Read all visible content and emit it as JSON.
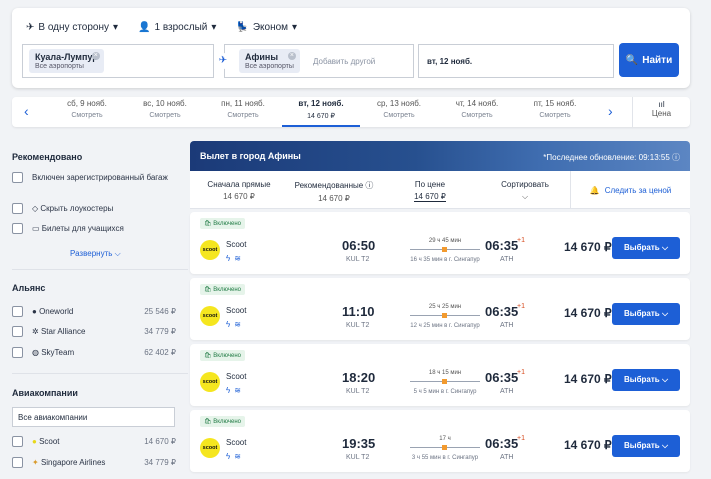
{
  "search": {
    "trip_type": "В одну сторону",
    "passengers": "1 взрослый",
    "cabin": "Эконом",
    "from": {
      "city": "Куала-Лумпур",
      "sub": "Все аэропорты"
    },
    "to": {
      "city": "Афины",
      "sub": "Все аэропорты"
    },
    "add_other": "Добавить другой",
    "date": "вт, 12 нояб.",
    "find_label": "Найти"
  },
  "dates": [
    {
      "day": "сб, 9 нояб.",
      "price": "Смотреть"
    },
    {
      "day": "вс, 10 нояб.",
      "price": "Смотреть"
    },
    {
      "day": "пн, 11 нояб.",
      "price": "Смотреть"
    },
    {
      "day": "вт, 12 нояб.",
      "price": "14 670 ₽",
      "selected": true
    },
    {
      "day": "ср, 13 нояб.",
      "price": "Смотреть"
    },
    {
      "day": "чт, 14 нояб.",
      "price": "Смотреть"
    },
    {
      "day": "пт, 15 нояб.",
      "price": "Смотреть"
    }
  ],
  "price_chart_label": "Цена",
  "sidebar": {
    "recommended_title": "Рекомендовано",
    "recommended": [
      "Включен зарегистрированный багаж",
      "Скрыть лоукостеры",
      "Билеты для учащихся"
    ],
    "expand": "Развернуть",
    "alliance_title": "Альянс",
    "alliances": [
      {
        "name": "Oneworld",
        "price": "25 546 ₽"
      },
      {
        "name": "Star Alliance",
        "price": "34 779 ₽"
      },
      {
        "name": "SkyTeam",
        "price": "62 402 ₽"
      }
    ],
    "airlines_title": "Авиакомпании",
    "airlines_all": "Все авиакомпании",
    "airlines": [
      {
        "name": "Scoot",
        "price": "14 670 ₽"
      },
      {
        "name": "Singapore Airlines",
        "price": "34 779 ₽"
      }
    ]
  },
  "results": {
    "banner_title": "Вылет в город Афины",
    "updated": "*Последнее обновление: 09:13:55",
    "sort": [
      {
        "label": "Сначала прямые",
        "value": "14 670 ₽"
      },
      {
        "label": "Рекомендованные",
        "value": "14 670 ₽"
      },
      {
        "label": "По цене",
        "value": "14 670 ₽"
      },
      {
        "label": "Сортировать",
        "value": ""
      }
    ],
    "watch_price": "Следить за ценой",
    "flights": [
      {
        "included": "Включено",
        "airline": "Scoot",
        "logo": "scoot",
        "dep": "06:50",
        "dep_code": "KUL T2",
        "duration": "29 ч 45 мин",
        "via": "16 ч 35 мин в г. Сингапур",
        "arr": "06:35",
        "arr_plus": "+1",
        "arr_code": "ATH",
        "price": "14 670 ₽",
        "select": "Выбрать"
      },
      {
        "included": "Включено",
        "airline": "Scoot",
        "logo": "scoot",
        "dep": "11:10",
        "dep_code": "KUL T2",
        "duration": "25 ч 25 мин",
        "via": "12 ч 25 мин в г. Сингапур",
        "arr": "06:35",
        "arr_plus": "+1",
        "arr_code": "ATH",
        "price": "14 670 ₽",
        "select": "Выбрать"
      },
      {
        "included": "Включено",
        "airline": "Scoot",
        "logo": "scoot",
        "dep": "18:20",
        "dep_code": "KUL T2",
        "duration": "18 ч 15 мин",
        "via": "5 ч 5 мин в г. Сингапур",
        "arr": "06:35",
        "arr_plus": "+1",
        "arr_code": "ATH",
        "price": "14 670 ₽",
        "select": "Выбрать"
      },
      {
        "included": "Включено",
        "airline": "Scoot",
        "logo": "scoot",
        "dep": "19:35",
        "dep_code": "KUL T2",
        "duration": "17 ч",
        "via": "3 ч 55 мин в г. Сингапур",
        "arr": "06:35",
        "arr_plus": "+1",
        "arr_code": "ATH",
        "price": "14 670 ₽",
        "select": "Выбрать"
      }
    ]
  }
}
